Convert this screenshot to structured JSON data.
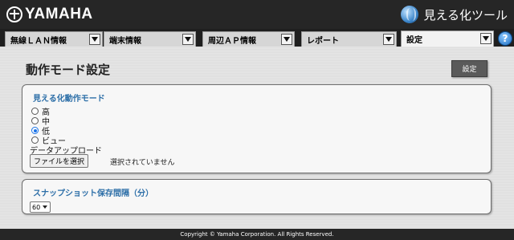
{
  "header": {
    "brand": "YAMAHA",
    "app_title": "見える化ツール"
  },
  "tabs": [
    {
      "label": "無線ＬＡＮ情報"
    },
    {
      "label": "端末情報"
    },
    {
      "label": "周辺ＡＰ情報"
    },
    {
      "label": "レポート"
    },
    {
      "label": "設定",
      "active": true
    }
  ],
  "help_label": "?",
  "main": {
    "page_title": "動作モード設定",
    "settings_button": "設定",
    "mode_panel": {
      "title": "見える化動作モード",
      "options": [
        {
          "label": "高",
          "checked": false
        },
        {
          "label": "中",
          "checked": false
        },
        {
          "label": "低",
          "checked": true
        },
        {
          "label": "ビュー",
          "checked": false
        }
      ],
      "upload_label": "データアップロード",
      "file_button": "ファイルを選択",
      "file_status": "選択されていません"
    },
    "snapshot_panel": {
      "title": "スナップショット保存間隔（分）",
      "interval_value": "60"
    }
  },
  "footer": {
    "copyright": "Copyright © Yamaha Corporation. All Rights Reserved."
  },
  "colors": {
    "header_bg": "#262626",
    "panel_title": "#2d6fa8",
    "radio_checked": "#1a73e8"
  }
}
